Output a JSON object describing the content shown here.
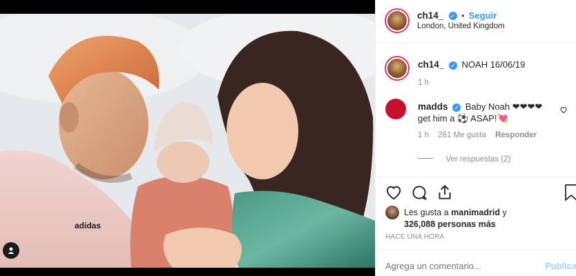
{
  "post": {
    "username": "ch14_",
    "follow_label": "Seguir",
    "dot": "•",
    "location": "London, United Kingdom",
    "caption_text": "NOAH 16/06/19",
    "caption_time": "1 h",
    "verified_mark": "✓"
  },
  "comment": {
    "username": "madds",
    "text_line1": "Baby Noah ❤❤❤❤",
    "text_line2": "get him a ⚽ ASAP!💘",
    "time": "1 h",
    "likes": "261 Me gusta",
    "reply_label": "Responder",
    "view_replies": "Ver respuestas (2)"
  },
  "likes": {
    "line1_prefix": "Les gusta a",
    "line1_user": "manimadrid",
    "line1_suffix": "y",
    "line2": "326,088 personas más"
  },
  "timestamp": "HACE UNA HORA",
  "comment_box": {
    "placeholder": "Agrega un comentario...",
    "publish_label": "Publicar"
  },
  "shirt_logo": "adidas",
  "icons": {
    "like": "heart-icon",
    "comment": "comment-icon",
    "share": "share-icon",
    "save": "bookmark-icon",
    "tag": "user-tag-icon"
  },
  "colors": {
    "link_blue": "#3897f0",
    "muted": "#8e8e8e",
    "verified": "#3897f0",
    "madds_avatar": "#c8102e"
  }
}
